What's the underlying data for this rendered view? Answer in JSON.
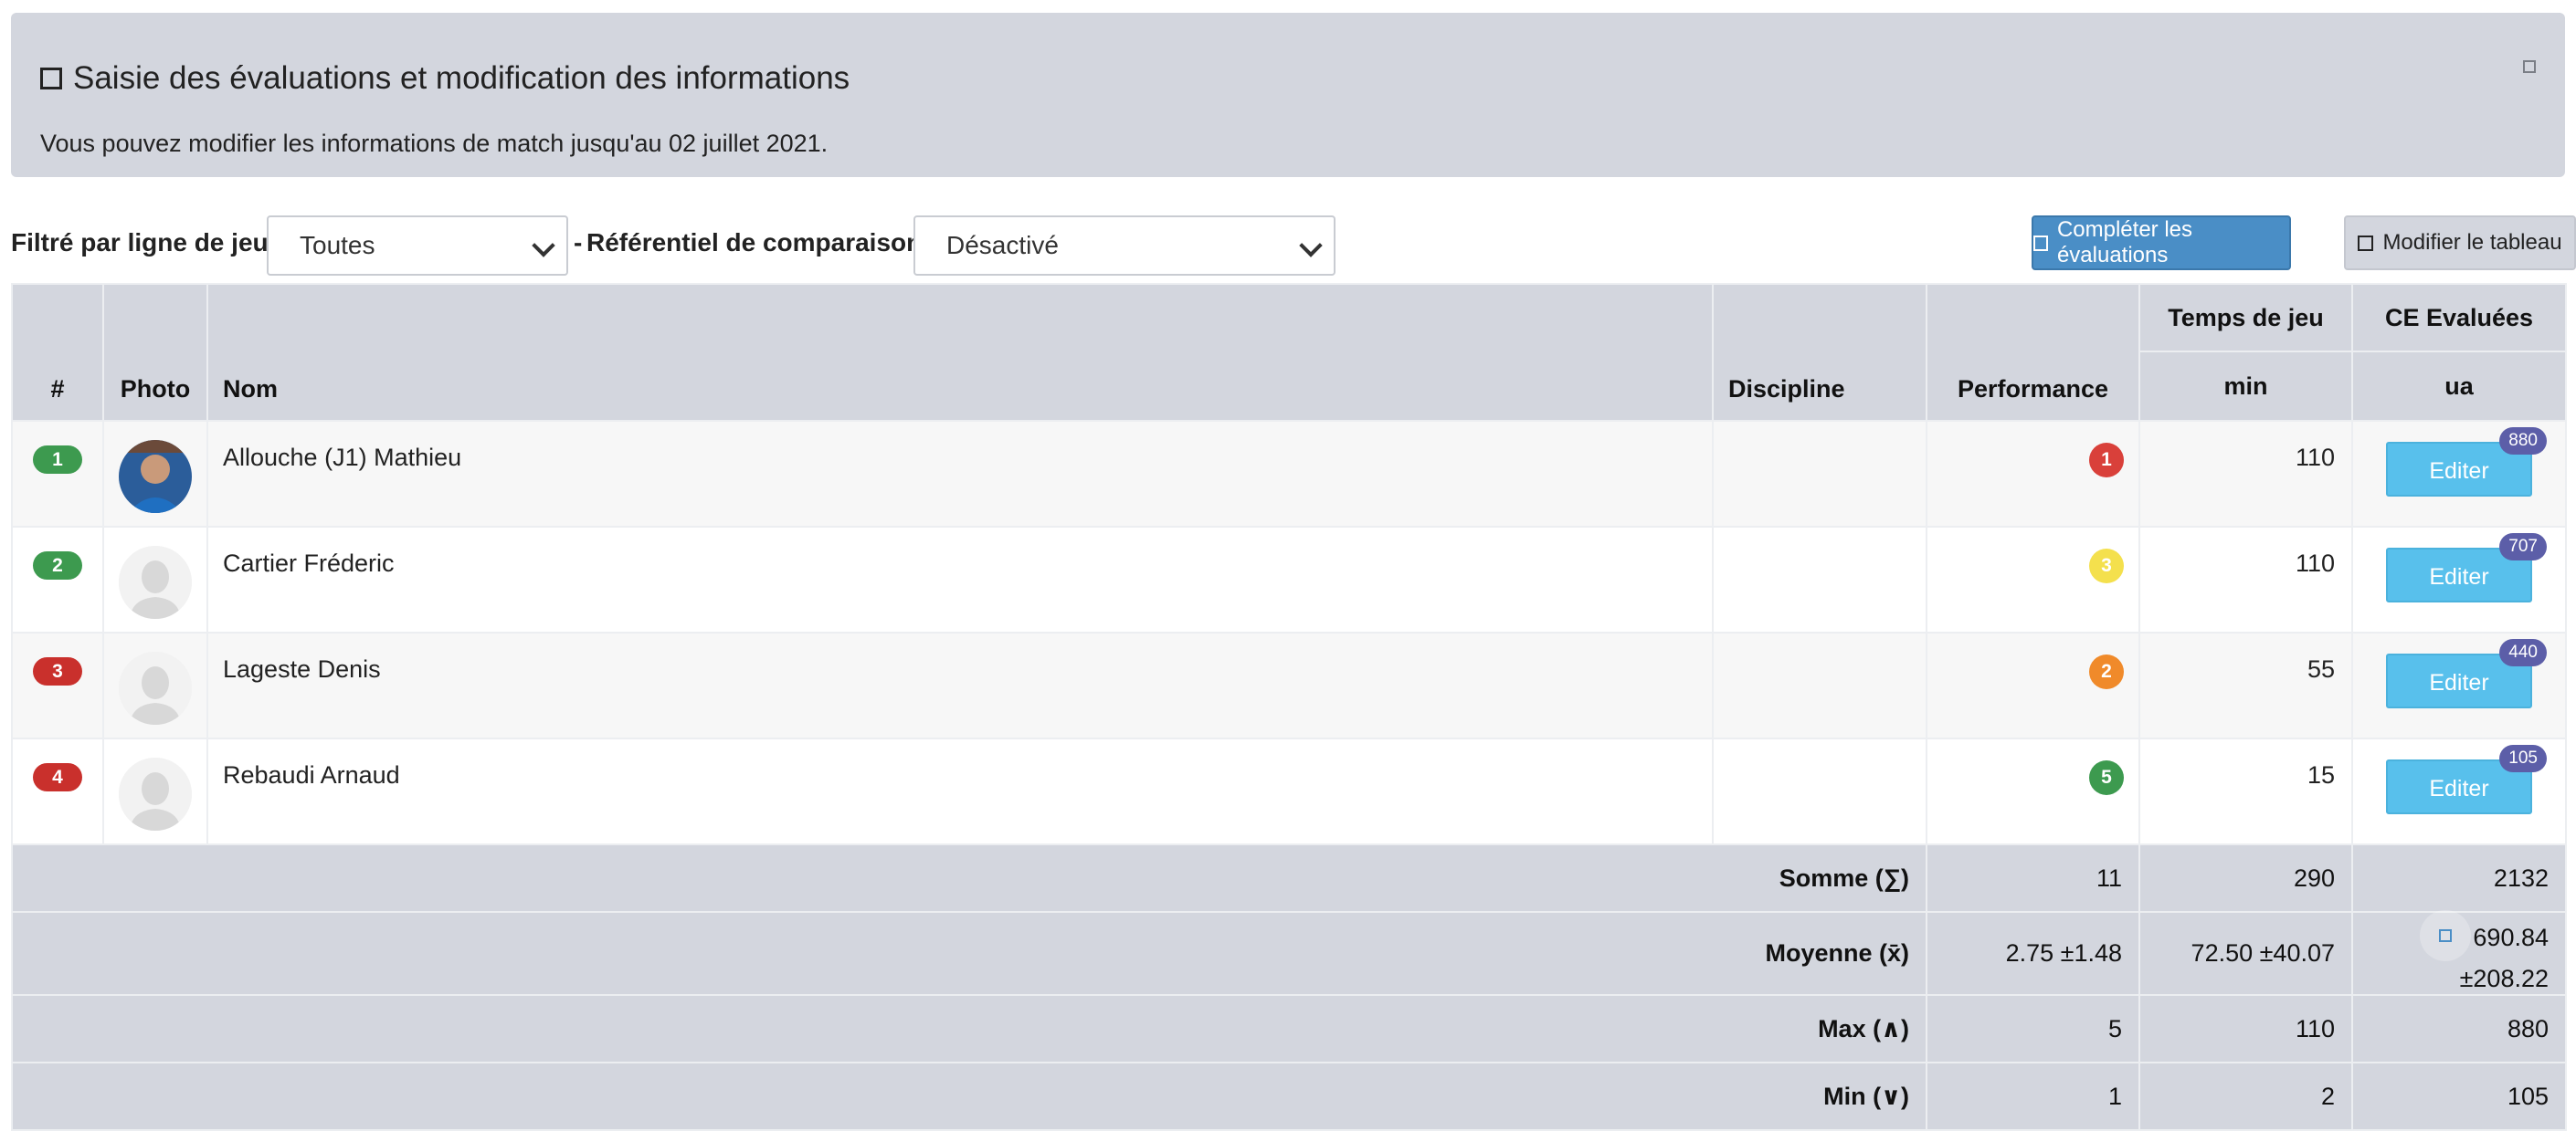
{
  "header": {
    "title": "Saisie des évaluations et modification des informations",
    "subtitle": "Vous pouvez modifier les informations de match jusqu'au 02 juillet 2021."
  },
  "filters": {
    "line_label": "Filtré par ligne de jeu :",
    "line_value": "Toutes",
    "separator": "-",
    "ref_label": "Référentiel de comparaison :",
    "ref_value": "Désactivé"
  },
  "toolbar": {
    "complete_label": "Compléter les évaluations",
    "modify_label": "Modifier le tableau"
  },
  "columns": {
    "num": "#",
    "photo": "Photo",
    "name": "Nom",
    "discipline": "Discipline",
    "performance": "Performance",
    "playtime": "Temps de jeu",
    "playtime_unit": "min",
    "ce": "CE Evaluées",
    "ce_unit": "ua"
  },
  "rows": [
    {
      "num": "1",
      "num_color": "#3d9a4f",
      "name": "Allouche (J1) Mathieu",
      "discipline": "",
      "perf": "1",
      "perf_color": "#d9403a",
      "time": "110",
      "edit_label": "Editer",
      "ce_count": "880"
    },
    {
      "num": "2",
      "num_color": "#3d9a4f",
      "name": "Cartier Fréderic",
      "discipline": "",
      "perf": "3",
      "perf_color": "#f4e04d",
      "time": "110",
      "edit_label": "Editer",
      "ce_count": "707"
    },
    {
      "num": "3",
      "num_color": "#c9302c",
      "name": "Lageste Denis",
      "discipline": "",
      "perf": "2",
      "perf_color": "#f08a2a",
      "time": "55",
      "edit_label": "Editer",
      "ce_count": "440"
    },
    {
      "num": "4",
      "num_color": "#c9302c",
      "name": "Rebaudi Arnaud",
      "discipline": "",
      "perf": "5",
      "perf_color": "#3d9a4f",
      "time": "15",
      "edit_label": "Editer",
      "ce_count": "105"
    }
  ],
  "summary": [
    {
      "label": "Somme (∑)",
      "perf": "11",
      "time": "290",
      "ce": "2132"
    },
    {
      "label": "Moyenne (x̄)",
      "perf": "2.75 ±1.48",
      "time": "72.50 ±40.07",
      "ce": "690.84 ±208.22"
    },
    {
      "label": "Max (∧)",
      "perf": "5",
      "time": "110",
      "ce": "880"
    },
    {
      "label": "Min (∨)",
      "perf": "1",
      "time": "2",
      "ce": "105"
    }
  ],
  "icons": {
    "title_icon": "square-icon",
    "close_icon": "square-icon",
    "avatar_placeholder": "user-silhouette-icon"
  }
}
